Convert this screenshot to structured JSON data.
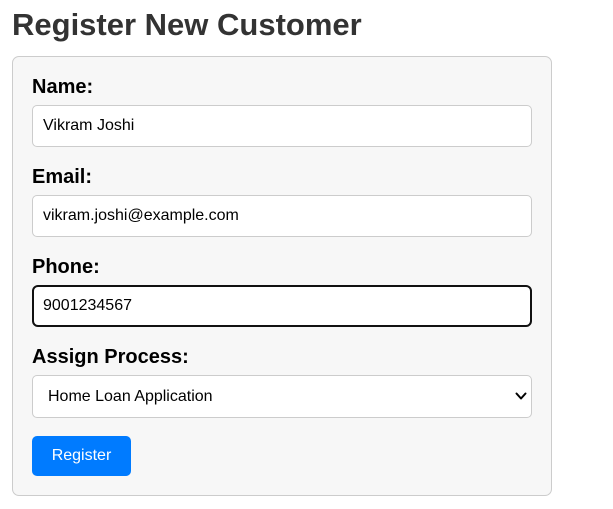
{
  "page": {
    "title": "Register New Customer"
  },
  "form": {
    "name": {
      "label": "Name:",
      "value": "Vikram Joshi"
    },
    "email": {
      "label": "Email:",
      "value": "vikram.joshi@example.com"
    },
    "phone": {
      "label": "Phone:",
      "value": "9001234567"
    },
    "process": {
      "label": "Assign Process:",
      "selected": "Home Loan Application",
      "icon": "chevron-down-icon"
    },
    "submit_label": "Register"
  },
  "colors": {
    "title": "#333333",
    "card_background": "#f7f7f7",
    "card_border": "#cccccc",
    "button_background": "#007bff",
    "button_text": "#ffffff",
    "focused_border": "#111111"
  }
}
